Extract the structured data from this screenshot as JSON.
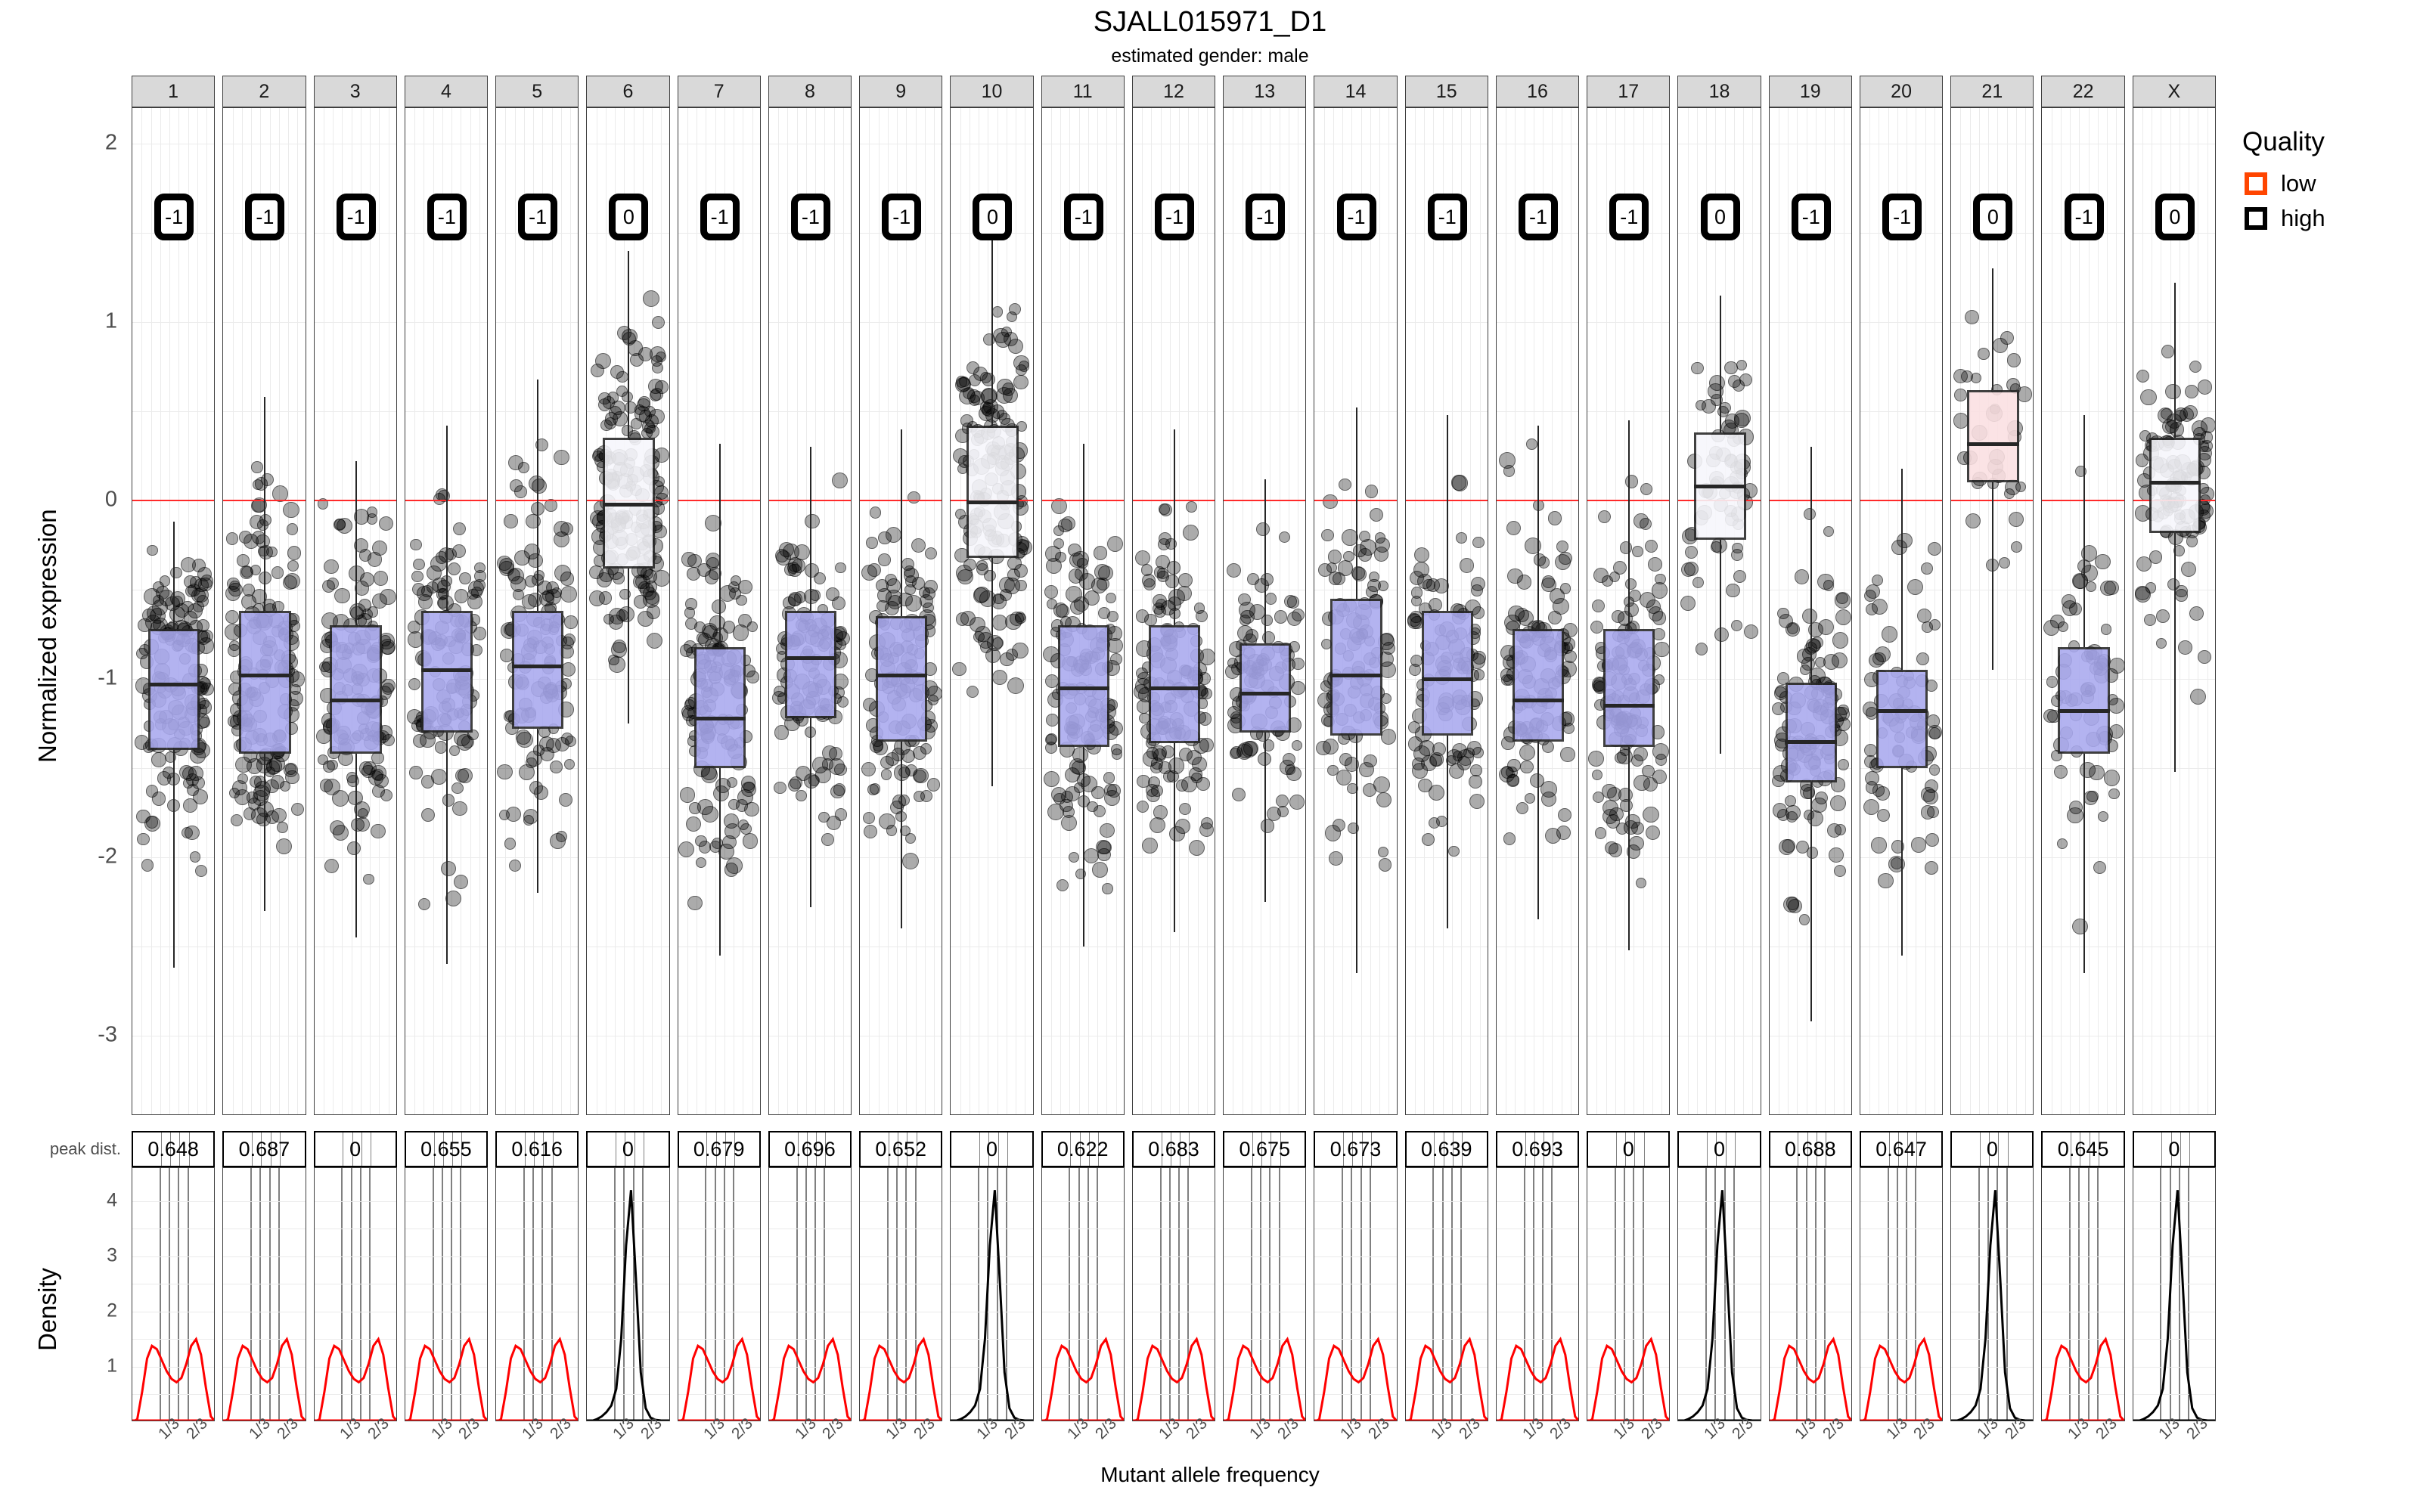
{
  "header": {
    "title": "SJALL015971_D1",
    "subtitle": "estimated gender: male"
  },
  "axes": {
    "y_expression_title": "Normalized expression",
    "y_density_title": "Density",
    "x_title": "Mutant allele frequency",
    "y_expression_ticks": [
      "2",
      "1",
      "0",
      "-1",
      "-2",
      "-3"
    ],
    "y_density_ticks": [
      "4",
      "3",
      "2",
      "1"
    ],
    "x_ticks": [
      "1/3",
      "2/3"
    ],
    "peak_dist_label": "peak dist.",
    "zero_line_color": "#ff2a2a"
  },
  "legend": {
    "title": "Quality",
    "items": [
      {
        "label": "low",
        "color": "#FF4500"
      },
      {
        "label": "high",
        "color": "#000000"
      }
    ]
  },
  "colors": {
    "box_loss": "#a9a9ef",
    "box_neutral": "#f7f7fc",
    "box_gain": "#fbe0e2",
    "strip_bg": "#d9d9d9",
    "dot": "rgba(0,0,0,0.33)",
    "density_low": "#FF0000",
    "density_high": "#000000"
  },
  "chart_data": {
    "type": "box",
    "title": "SJALL015971_D1",
    "subtitle": "estimated gender: male",
    "xlabel": "Mutant allele frequency",
    "ylabel": "Normalized expression",
    "ylim": [
      -3.45,
      2.2
    ],
    "xlim": [
      0,
      1
    ],
    "x_tick_values": [
      0.3333,
      0.6667
    ],
    "facet_variable": "chromosome",
    "grid": true,
    "reference_line_y": 0,
    "panels": [
      {
        "chrom": "1",
        "cn": "-1",
        "quality": "low",
        "peak_dist": "0.648",
        "box": {
          "q1": -1.4,
          "median": -1.03,
          "q3": -0.72,
          "lo": -2.62,
          "hi": -0.12
        },
        "n": 150
      },
      {
        "chrom": "2",
        "cn": "-1",
        "quality": "low",
        "peak_dist": "0.687",
        "box": {
          "q1": -1.42,
          "median": -0.98,
          "q3": -0.62,
          "lo": -2.3,
          "hi": 0.58
        },
        "n": 160
      },
      {
        "chrom": "3",
        "cn": "-1",
        "quality": "low",
        "peak_dist": "0",
        "box": {
          "q1": -1.42,
          "median": -1.12,
          "q3": -0.7,
          "lo": -2.45,
          "hi": 0.22
        },
        "n": 140
      },
      {
        "chrom": "4",
        "cn": "-1",
        "quality": "low",
        "peak_dist": "0.655",
        "box": {
          "q1": -1.3,
          "median": -0.95,
          "q3": -0.62,
          "lo": -2.6,
          "hi": 0.42
        },
        "n": 120
      },
      {
        "chrom": "5",
        "cn": "-1",
        "quality": "low",
        "peak_dist": "0.616",
        "box": {
          "q1": -1.28,
          "median": -0.93,
          "q3": -0.62,
          "lo": -2.2,
          "hi": 0.68
        },
        "n": 125
      },
      {
        "chrom": "6",
        "cn": "0",
        "quality": "high",
        "peak_dist": "0",
        "box": {
          "q1": -0.38,
          "median": -0.02,
          "q3": 0.35,
          "lo": -1.25,
          "hi": 1.4
        },
        "n": 175
      },
      {
        "chrom": "7",
        "cn": "-1",
        "quality": "low",
        "peak_dist": "0.679",
        "box": {
          "q1": -1.5,
          "median": -1.22,
          "q3": -0.82,
          "lo": -2.55,
          "hi": 0.32
        },
        "n": 140
      },
      {
        "chrom": "8",
        "cn": "-1",
        "quality": "low",
        "peak_dist": "0.696",
        "box": {
          "q1": -1.22,
          "median": -0.88,
          "q3": -0.62,
          "lo": -2.28,
          "hi": 0.3
        },
        "n": 120
      },
      {
        "chrom": "9",
        "cn": "-1",
        "quality": "low",
        "peak_dist": "0.652",
        "box": {
          "q1": -1.35,
          "median": -0.98,
          "q3": -0.65,
          "lo": -2.4,
          "hi": 0.4
        },
        "n": 130
      },
      {
        "chrom": "10",
        "cn": "0",
        "quality": "high",
        "peak_dist": "0",
        "box": {
          "q1": -0.32,
          "median": -0.01,
          "q3": 0.42,
          "lo": -1.6,
          "hi": 1.58
        },
        "n": 165
      },
      {
        "chrom": "11",
        "cn": "-1",
        "quality": "low",
        "peak_dist": "0.622",
        "box": {
          "q1": -1.38,
          "median": -1.05,
          "q3": -0.7,
          "lo": -2.5,
          "hi": 0.32
        },
        "n": 145
      },
      {
        "chrom": "12",
        "cn": "-1",
        "quality": "low",
        "peak_dist": "0.683",
        "box": {
          "q1": -1.36,
          "median": -1.05,
          "q3": -0.7,
          "lo": -2.42,
          "hi": 0.4
        },
        "n": 140
      },
      {
        "chrom": "13",
        "cn": "-1",
        "quality": "low",
        "peak_dist": "0.675",
        "box": {
          "q1": -1.3,
          "median": -1.08,
          "q3": -0.8,
          "lo": -2.25,
          "hi": 0.12
        },
        "n": 95
      },
      {
        "chrom": "14",
        "cn": "-1",
        "quality": "low",
        "peak_dist": "0.673",
        "box": {
          "q1": -1.32,
          "median": -0.98,
          "q3": -0.55,
          "lo": -2.65,
          "hi": 0.52
        },
        "n": 110
      },
      {
        "chrom": "15",
        "cn": "-1",
        "quality": "low",
        "peak_dist": "0.639",
        "box": {
          "q1": -1.32,
          "median": -1.0,
          "q3": -0.62,
          "lo": -2.4,
          "hi": 0.48
        },
        "n": 105
      },
      {
        "chrom": "16",
        "cn": "-1",
        "quality": "low",
        "peak_dist": "0.693",
        "box": {
          "q1": -1.35,
          "median": -1.12,
          "q3": -0.72,
          "lo": -2.35,
          "hi": 0.42
        },
        "n": 120
      },
      {
        "chrom": "17",
        "cn": "-1",
        "quality": "low",
        "peak_dist": "0",
        "box": {
          "q1": -1.38,
          "median": -1.15,
          "q3": -0.72,
          "lo": -2.52,
          "hi": 0.45
        },
        "n": 135
      },
      {
        "chrom": "18",
        "cn": "0",
        "quality": "high",
        "peak_dist": "0",
        "box": {
          "q1": -0.22,
          "median": 0.08,
          "q3": 0.38,
          "lo": -1.42,
          "hi": 1.15
        },
        "n": 70
      },
      {
        "chrom": "19",
        "cn": "-1",
        "quality": "low",
        "peak_dist": "0.688",
        "box": {
          "q1": -1.58,
          "median": -1.35,
          "q3": -1.02,
          "lo": -2.92,
          "hi": 0.3
        },
        "n": 125
      },
      {
        "chrom": "20",
        "cn": "-1",
        "quality": "low",
        "peak_dist": "0.647",
        "box": {
          "q1": -1.5,
          "median": -1.18,
          "q3": -0.95,
          "lo": -2.55,
          "hi": 0.18
        },
        "n": 80
      },
      {
        "chrom": "21",
        "cn": "0",
        "quality": "high",
        "peak_dist": "0",
        "box": {
          "q1": 0.1,
          "median": 0.32,
          "q3": 0.62,
          "lo": -0.95,
          "hi": 1.3
        },
        "n": 35
      },
      {
        "chrom": "22",
        "cn": "-1",
        "quality": "low",
        "peak_dist": "0.645",
        "box": {
          "q1": -1.42,
          "median": -1.18,
          "q3": -0.82,
          "lo": -2.65,
          "hi": 0.48
        },
        "n": 70
      },
      {
        "chrom": "X",
        "cn": "0",
        "quality": "high",
        "peak_dist": "0",
        "box": {
          "q1": -0.18,
          "median": 0.1,
          "q3": 0.35,
          "lo": -1.52,
          "hi": 1.22
        },
        "n": 115
      }
    ],
    "density": {
      "type": "line",
      "ylabel": "Density",
      "xlabel": "Mutant allele frequency",
      "ylim": [
        0,
        4.6
      ],
      "xlim": [
        0,
        1
      ],
      "low_profile": [
        0.0,
        0.05,
        0.55,
        1.15,
        1.38,
        1.32,
        1.12,
        0.92,
        0.78,
        0.72,
        0.8,
        1.05,
        1.38,
        1.5,
        1.22,
        0.62,
        0.1,
        0.0
      ],
      "high_profile": [
        0.0,
        0.02,
        0.05,
        0.1,
        0.18,
        0.3,
        0.6,
        1.5,
        3.2,
        4.2,
        2.6,
        0.9,
        0.25,
        0.08,
        0.04,
        0.03,
        0.01,
        0.0
      ]
    }
  }
}
